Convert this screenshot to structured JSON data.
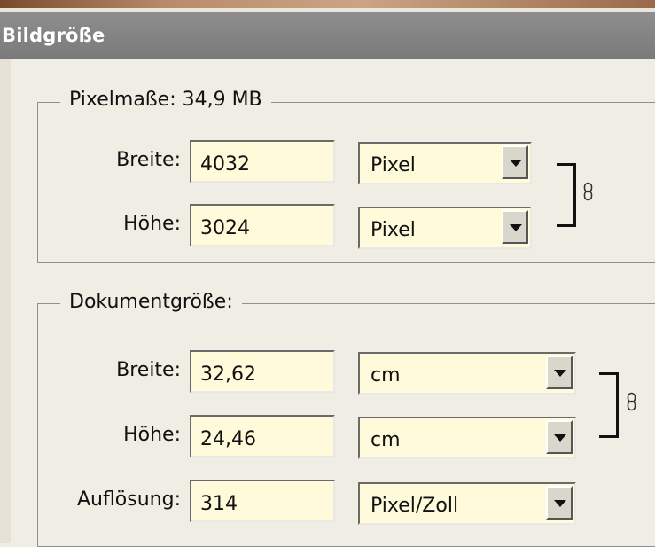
{
  "window": {
    "title": "Bildgröße"
  },
  "pixel_dimensions": {
    "legend": "Pixelmaße: 34,9 MB",
    "width": {
      "label": "Breite:",
      "value": "4032",
      "unit": "Pixel"
    },
    "height": {
      "label": "Höhe:",
      "value": "3024",
      "unit": "Pixel"
    }
  },
  "document_size": {
    "legend": "Dokumentgröße:",
    "width": {
      "label": "Breite:",
      "value": "32,62",
      "unit": "cm"
    },
    "height": {
      "label": "Höhe:",
      "value": "24,46",
      "unit": "cm"
    },
    "resolution": {
      "label": "Auflösung:",
      "value": "314",
      "unit": "Pixel/Zoll"
    }
  },
  "colors": {
    "field_background": "#fffad9",
    "title_bar": "#8a8a8a",
    "dialog_background": "#f0ede4"
  },
  "icons": {
    "dropdown": "triangle-down",
    "link": "chain-link"
  }
}
